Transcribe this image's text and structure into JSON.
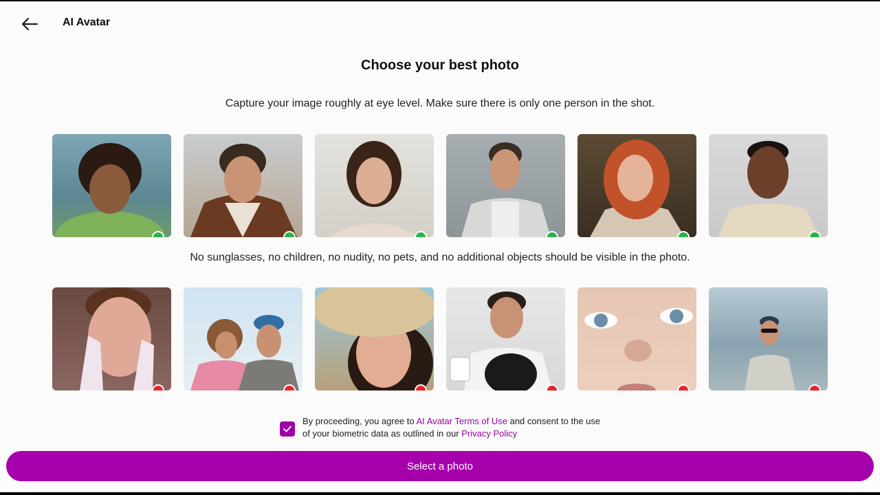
{
  "header": {
    "title": "AI Avatar",
    "back_icon": "arrow-left-icon"
  },
  "main": {
    "heading": "Choose your best photo",
    "good_instruction": "Capture your image roughly at eye level. Make sure there is only one person in the shot.",
    "bad_instruction": "No sunglasses, no children, no nudity, no pets, and no additional objects should be visible in the photo.",
    "good_examples_status": "check-icon",
    "bad_examples_status": "cross-icon"
  },
  "consent": {
    "checked": true,
    "text_1": "By proceeding, you agree to ",
    "terms_link": "AI Avatar Terms of Use",
    "text_2": " and consent to the use of your biometric data as outlined in our ",
    "privacy_link": "Privacy Policy"
  },
  "cta": {
    "label": "Select a photo"
  },
  "colors": {
    "accent": "#a600ad",
    "good": "#2bb34a",
    "bad": "#e5262d"
  }
}
